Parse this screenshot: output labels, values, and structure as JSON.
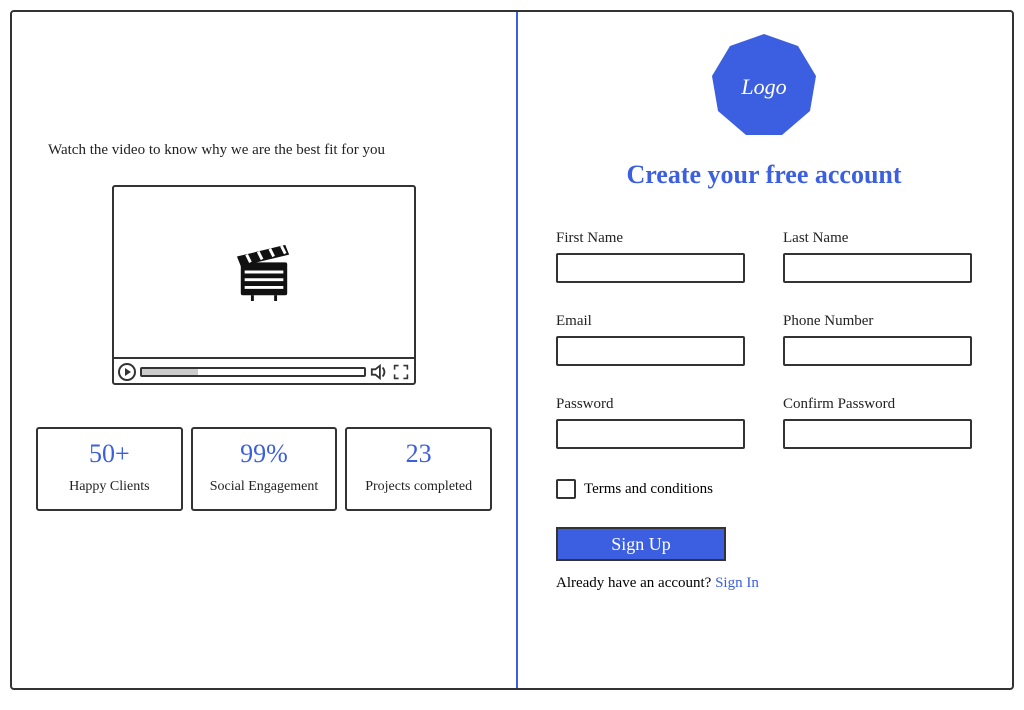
{
  "left": {
    "tagline": "Watch the video to know why we are the best fit for you",
    "stats": [
      {
        "value": "50+",
        "label": "Happy Clients"
      },
      {
        "value": "99%",
        "label": "Social Engagement"
      },
      {
        "value": "23",
        "label": "Projects completed"
      }
    ]
  },
  "logo": {
    "text": "Logo"
  },
  "form": {
    "title": "Create your free account",
    "fields": {
      "first_name": {
        "label": "First Name",
        "value": ""
      },
      "last_name": {
        "label": "Last Name",
        "value": ""
      },
      "email": {
        "label": "Email",
        "value": ""
      },
      "phone": {
        "label": "Phone Number",
        "value": ""
      },
      "password": {
        "label": "Password",
        "value": ""
      },
      "confirm_password": {
        "label": "Confirm Password",
        "value": ""
      }
    },
    "terms_label": "Terms and conditions",
    "submit_label": "Sign Up",
    "signin_prompt": "Already have an account?",
    "signin_link": "Sign In"
  },
  "colors": {
    "accent": "#3b5fe0"
  }
}
